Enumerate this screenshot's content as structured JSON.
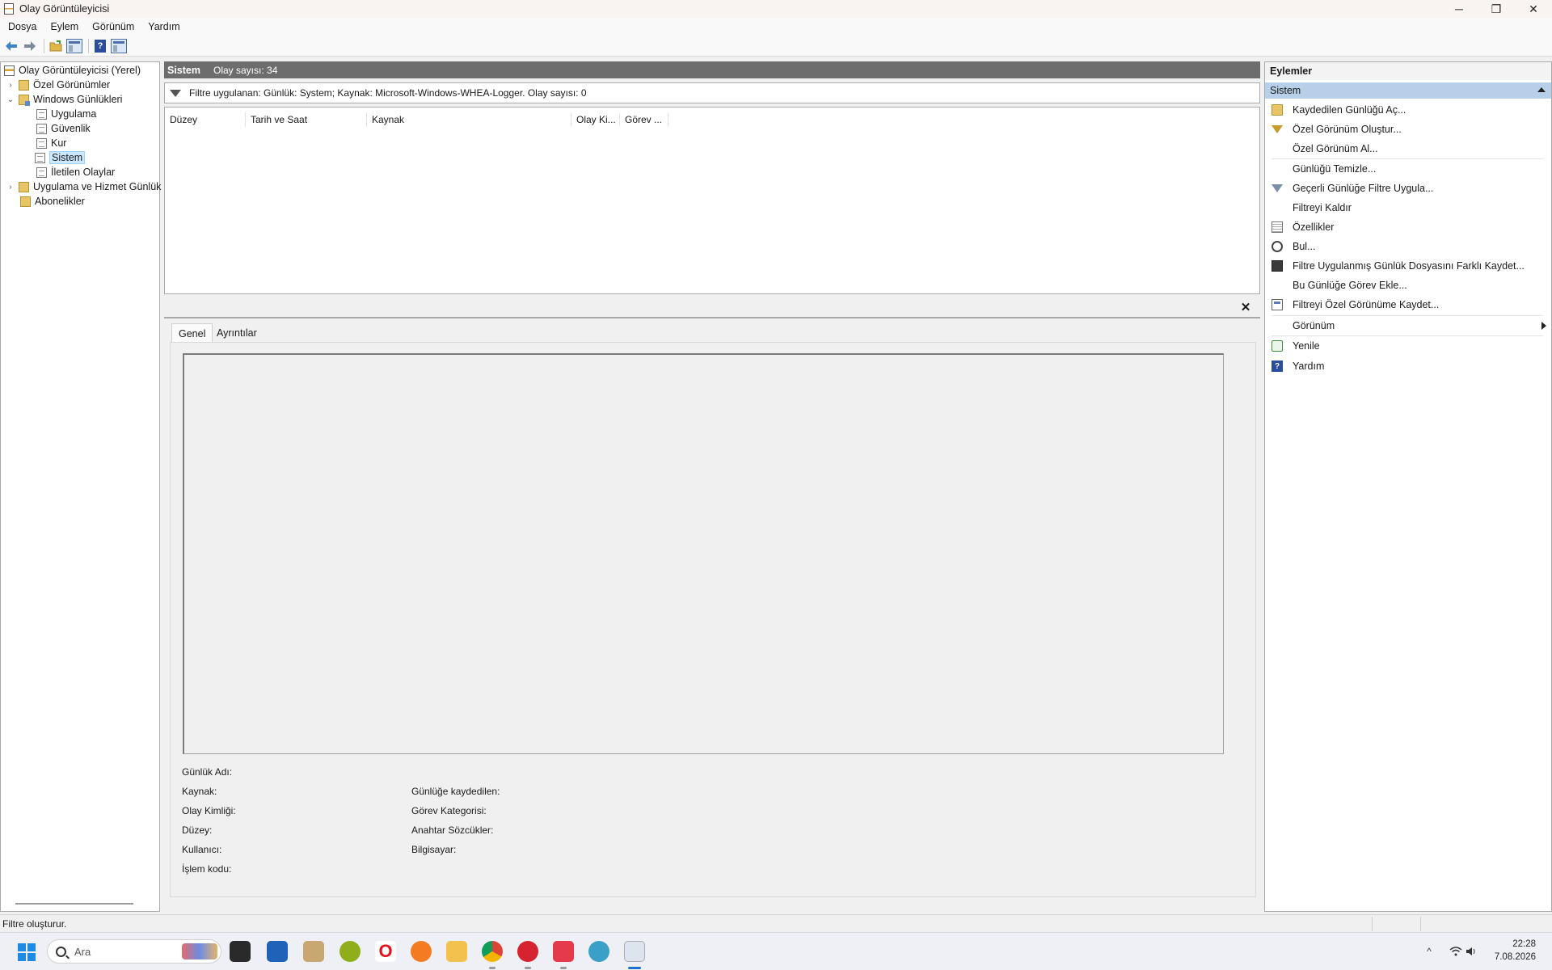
{
  "window": {
    "title": "Olay Görüntüleyicisi",
    "controls": [
      "─",
      "❐",
      "✕"
    ]
  },
  "menu": [
    "Dosya",
    "Eylem",
    "Görünüm",
    "Yardım"
  ],
  "toolbar_icons": [
    "back-arrow-icon",
    "forward-arrow-icon",
    "open-folder-icon",
    "console-tree-icon",
    "help-icon",
    "action-pane-icon"
  ],
  "tree": {
    "root": "Olay Görüntüleyicisi (Yerel)",
    "custom_views": "Özel Görünümler",
    "windows_logs": "Windows Günlükleri",
    "logs": [
      "Uygulama",
      "Güvenlik",
      "Kur",
      "Sistem",
      "İletilen Olaylar"
    ],
    "app_service_logs": "Uygulama ve Hizmet Günlük",
    "subscriptions": "Abonelikler",
    "selected": "Sistem"
  },
  "center": {
    "log_name": "Sistem",
    "event_count": "Olay sayısı: 34",
    "filter_text": "Filtre uygulanan: Günlük: System; Kaynak: Microsoft-Windows-WHEA-Logger. Olay sayısı: 0",
    "columns": [
      "Düzey",
      "Tarih ve Saat",
      "Kaynak",
      "Olay Ki...",
      "Görev ..."
    ]
  },
  "detail": {
    "close": "✕",
    "tabs": [
      "Genel",
      "Ayrıntılar"
    ],
    "active_tab": "Genel",
    "fields_left": [
      "Günlük Adı:",
      "Kaynak:",
      "Olay Kimliği:",
      "Düzey:",
      "Kullanıcı:",
      "İşlem kodu:"
    ],
    "fields_right": [
      "Günlüğe kaydedilen:",
      "Görev Kategorisi:",
      "Anahtar Sözcükler:",
      "Bilgisayar:"
    ]
  },
  "actions": {
    "title": "Eylemler",
    "section": "Sistem",
    "items": [
      {
        "label": "Kaydedilen Günlüğü Aç...",
        "icon": "open-log-icon"
      },
      {
        "label": "Özel Görünüm Oluştur...",
        "icon": "create-view-icon"
      },
      {
        "label": "Özel Görünüm Al...",
        "icon": ""
      },
      {
        "label": "Günlüğü Temizle...",
        "icon": ""
      },
      {
        "label": "Geçerli Günlüğe Filtre Uygula...",
        "icon": "filter-icon"
      },
      {
        "label": "Filtreyi Kaldır",
        "icon": ""
      },
      {
        "label": "Özellikler",
        "icon": "properties-icon"
      },
      {
        "label": "Bul...",
        "icon": "find-icon"
      },
      {
        "label": "Filtre Uygulanmış Günlük Dosyasını Farklı Kaydet...",
        "icon": "save-icon"
      },
      {
        "label": "Bu Günlüğe Görev Ekle...",
        "icon": ""
      },
      {
        "label": "Filtreyi Özel Görünüme Kaydet...",
        "icon": "save-view-icon"
      },
      {
        "label": "Görünüm",
        "icon": ""
      },
      {
        "label": "Yenile",
        "icon": "refresh-icon"
      },
      {
        "label": "Yardım",
        "icon": "help-icon"
      }
    ]
  },
  "status": {
    "text": "Filtre oluşturur."
  },
  "taskbar": {
    "search_placeholder": "Ara",
    "apps": [
      "file-manager-icon",
      "store-icon",
      "app-icon",
      "sun-icon",
      "opera-icon",
      "firefox-icon",
      "folder-icon",
      "chrome-icon",
      "red-app-icon",
      "pocket-icon",
      "edge-icon",
      "event-viewer-icon"
    ],
    "time": "22:28",
    "date": "7.08.2026",
    "colors": {
      "accent": "#1d6fd1",
      "selection": "#cce8ff",
      "section_header": "#b7cfe8",
      "header_bar": "#6d6d6d"
    }
  }
}
